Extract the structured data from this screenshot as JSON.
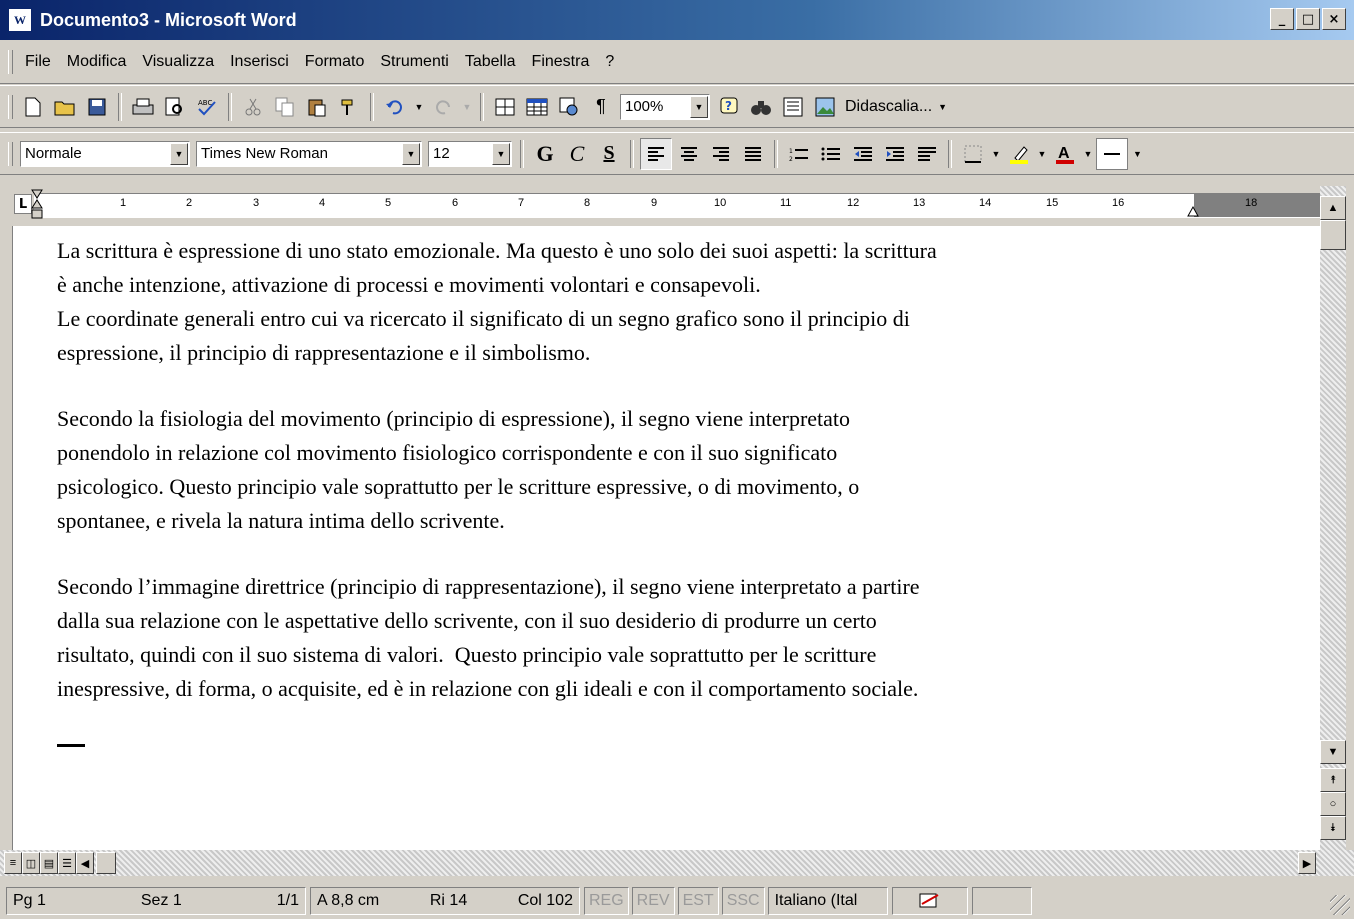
{
  "window": {
    "title": "Documento3 - Microsoft Word",
    "app_icon": "W",
    "minimize": "_",
    "maximize": "□",
    "close": "×"
  },
  "menu": [
    "File",
    "Modifica",
    "Visualizza",
    "Inserisci",
    "Formato",
    "Strumenti",
    "Tabella",
    "Finestra",
    "?"
  ],
  "toolbar_standard": {
    "zoom": "100%",
    "pilcrow": "¶",
    "caption_label": "Didascalia..."
  },
  "toolbar_format": {
    "style": "Normale",
    "font": "Times New Roman",
    "size": "12",
    "bold": "G",
    "italic": "C",
    "underline": "S"
  },
  "ruler": {
    "tab_marker": "L",
    "numbers": [
      "1",
      "2",
      "3",
      "4",
      "5",
      "6",
      "7",
      "8",
      "9",
      "10",
      "11",
      "12",
      "13",
      "14",
      "15",
      "16",
      "18"
    ]
  },
  "document": {
    "paragraphs": [
      "La scrittura è espressione di uno stato emozionale. Ma questo è uno solo dei suoi aspetti: la scrittura\nè anche intenzione, attivazione di processi e movimenti volontari e consapevoli.\nLe coordinate generali entro cui va ricercato il significato di un segno grafico sono il principio di\nespressione, il principio di rappresentazione e il simbolismo.",
      "Secondo la fisiologia del movimento (principio di espressione), il segno viene interpretato\nponendolo in relazione col movimento fisiologico corrispondente e con il suo significato\npsicologico. Questo principio vale soprattutto per le scritture espressive, o di movimento, o\nspontanee, e rivela la natura intima dello scrivente.",
      "Secondo l’immagine direttrice (principio di rappresentazione), il segno viene interpretato a partire\ndalla sua relazione con le aspettative dello scrivente, con il suo desiderio di produrre un certo\nrisultato, quindi con il suo sistema di valori.  Questo principio vale soprattutto per le scritture\ninespressive, di forma, o acquisite, ed è in relazione con gli ideali e con il comportamento sociale."
    ]
  },
  "status": {
    "page": "Pg 1",
    "section": "Sez 1",
    "pages": "1/1",
    "at": "A 8,8 cm",
    "line": "Ri 14",
    "col": "Col 102",
    "rec": "REG",
    "rev": "REV",
    "ext": "EST",
    "ovr": "SSC",
    "language": "Italiano (Ital"
  }
}
